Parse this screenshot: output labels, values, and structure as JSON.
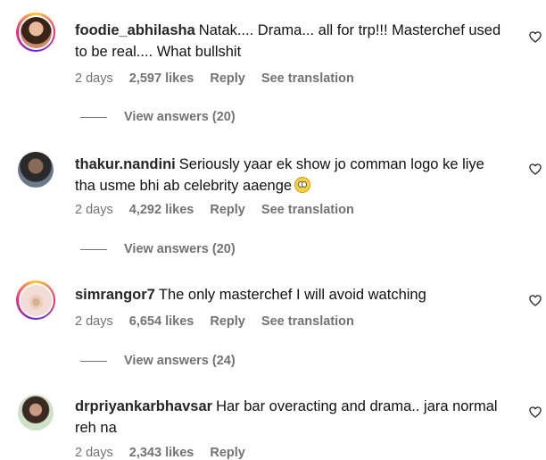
{
  "comments": [
    {
      "username": "foodie_abhilasha",
      "text": "Natak.... Drama... all for trp!!! Masterchef used to be real.... What bullshit",
      "time": "2 days",
      "likes": "2,597 likes",
      "reply": "Reply",
      "translation": "See translation",
      "view_answers": "View answers (20)",
      "avatar": "woman-portrait-avatar",
      "has_story_ring": true
    },
    {
      "username": "thakur.nandini",
      "text": "Seriously yaar ek show jo comman logo ke liye tha usme bhi ab celebrity aaenge",
      "emoji": "face-with-rolling-eyes-emoji",
      "time": "2 days",
      "likes": "4,292 likes",
      "reply": "Reply",
      "translation": "See translation",
      "view_answers": "View answers (20)",
      "avatar": "woman-portrait-avatar",
      "has_story_ring": false
    },
    {
      "username": "simrangor7",
      "text": "The only masterchef I will avoid watching",
      "time": "2 days",
      "likes": "6,654 likes",
      "reply": "Reply",
      "translation": "See translation",
      "view_answers": "View answers (24)",
      "avatar": "woman-full-figure-avatar",
      "has_story_ring": true
    },
    {
      "username": "drpriyankarbhavsar",
      "text": "Har bar overacting and drama.. jara normal reh na",
      "time": "2 days",
      "likes": "2,343 likes",
      "reply": "Reply",
      "avatar": "woman-portrait-avatar",
      "has_story_ring": false
    }
  ],
  "colors": {
    "username": "#262626",
    "meta": "#737373",
    "story_ring": [
      "#f9ce34",
      "#ee2a7b",
      "#6228d7"
    ]
  }
}
